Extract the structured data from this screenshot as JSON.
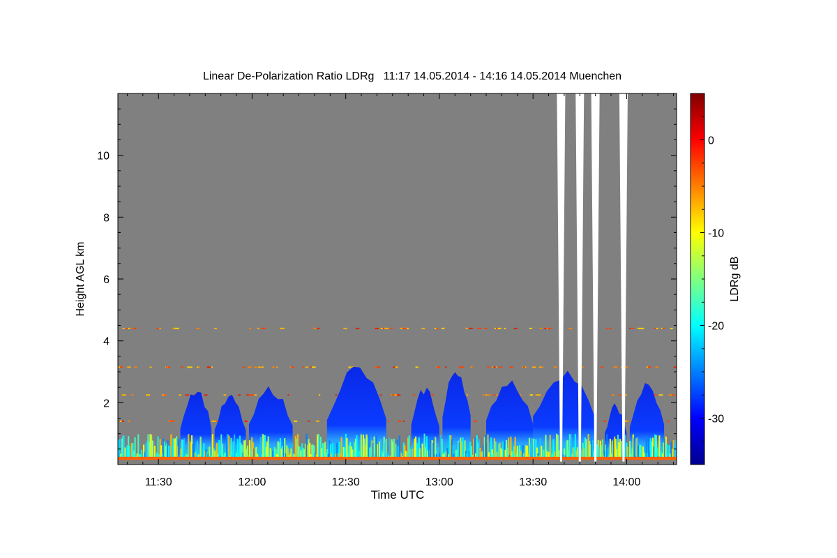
{
  "chart_data": {
    "type": "heatmap",
    "title": "Linear De-Polarization Ratio LDRg   11:17 14.05.2014 - 14:16 14.05.2014 Muenchen",
    "xlabel": "Time UTC",
    "ylabel": "Height AGL km",
    "xlim": [
      "11:17",
      "14:16"
    ],
    "ylim": [
      0,
      12
    ],
    "x_ticks": [
      "11:30",
      "12:00",
      "12:30",
      "13:00",
      "13:30",
      "14:00"
    ],
    "y_ticks": [
      2,
      4,
      6,
      8,
      10
    ],
    "colorbar": {
      "label": "LDRg dB",
      "range": [
        -35,
        5
      ],
      "ticks": [
        0,
        -10,
        -20,
        -30
      ],
      "colormap": "jet"
    },
    "colors": {
      "background": "#808080",
      "data_gap": "#ffffff"
    },
    "cloud_columns": [
      {
        "start": "11:37",
        "end": "11:47",
        "top": 2.6,
        "base": 0.25
      },
      {
        "start": "11:48",
        "end": "11:58",
        "top": 2.3,
        "base": 0.25
      },
      {
        "start": "11:59",
        "end": "12:13",
        "top": 2.6,
        "base": 0.25
      },
      {
        "start": "12:24",
        "end": "12:43",
        "top": 3.3,
        "base": 0.25
      },
      {
        "start": "12:51",
        "end": "13:00",
        "top": 2.6,
        "base": 0.25
      },
      {
        "start": "13:01",
        "end": "13:10",
        "top": 3.3,
        "base": 0.25
      },
      {
        "start": "13:15",
        "end": "13:30",
        "top": 2.9,
        "base": 0.25
      },
      {
        "start": "13:30",
        "end": "13:50",
        "top": 3.2,
        "base": 0.25
      },
      {
        "start": "13:53",
        "end": "14:00",
        "top": 2.0,
        "base": 0.25
      },
      {
        "start": "14:01",
        "end": "14:12",
        "top": 2.7,
        "base": 0.25
      }
    ],
    "data_gaps": [
      {
        "time": "13:39",
        "top": 12,
        "bottom": 0.1
      },
      {
        "time": "13:45",
        "top": 12,
        "bottom": 0.1
      },
      {
        "time": "13:50",
        "top": 12,
        "bottom": 0.1
      },
      {
        "time": "13:59",
        "top": 12,
        "bottom": 0.1
      }
    ]
  }
}
